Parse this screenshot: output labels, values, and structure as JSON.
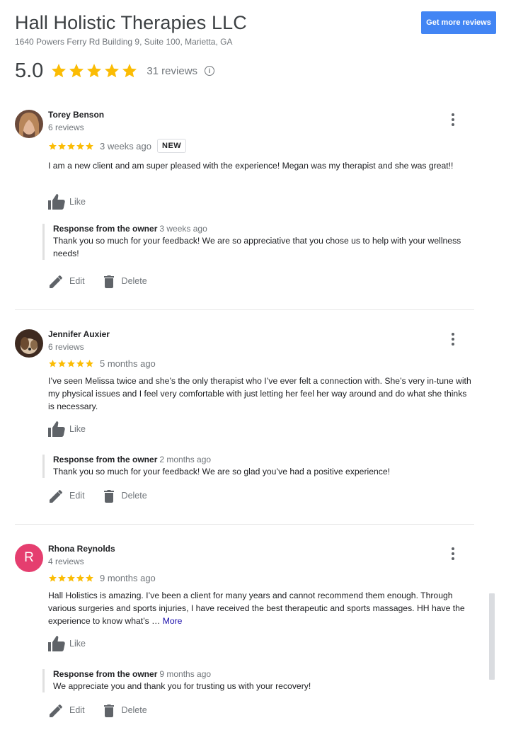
{
  "business": {
    "name": "Hall Holistic Therapies LLC",
    "address": "1640 Powers Ferry Rd Building 9, Suite 100, Marietta, GA",
    "get_more_label": "Get more reviews",
    "rating": "5.0",
    "stars": 5,
    "review_count": "31 reviews",
    "star_color": "#fbbc04"
  },
  "reviews": [
    {
      "name": "Torey Benson",
      "count": "6 reviews",
      "stars": 5,
      "time": "3 weeks ago",
      "badge": "NEW",
      "text": "I am a new client and am super pleased with the experience! Megan was my therapist and she was great!!",
      "more": "",
      "like": "Like",
      "response_label": "Response from the owner",
      "response_time": "3 weeks ago",
      "response_text": "Thank you so much for your feedback! We are so appreciative that you chose us to help with your wellness needs!",
      "edit": "Edit",
      "delete": "Delete"
    },
    {
      "name": "Jennifer Auxier",
      "count": "6 reviews",
      "stars": 5,
      "time": "5 months ago",
      "text": "I’ve seen Melissa twice and she’s the only therapist who I’ve ever felt a connection with. She’s very in-tune with my physical issues and I feel very comfortable with just letting her feel her way around and do what she thinks is necessary.",
      "more": "",
      "like": "Like",
      "response_label": "Response from the owner",
      "response_time": "2 months ago",
      "response_text": "Thank you so much for your feedback! We are so glad you’ve had a positive experience!",
      "edit": "Edit",
      "delete": "Delete"
    },
    {
      "name": "Rhona Reynolds",
      "initial": "R",
      "count": "4 reviews",
      "stars": 5,
      "time": "9 months ago",
      "text": "Hall Holistics is amazing.  I’ve been a client for many years and cannot recommend them enough. Through various surgeries and sports injuries, I have received the best therapeutic and sports massages. HH have the experience to know what’s … ",
      "more": "More",
      "like": "Like",
      "response_label": "Response from the owner",
      "response_time": "9 months ago",
      "response_text": "We appreciate you and thank you for trusting us with your recovery!",
      "edit": "Edit",
      "delete": "Delete"
    }
  ]
}
